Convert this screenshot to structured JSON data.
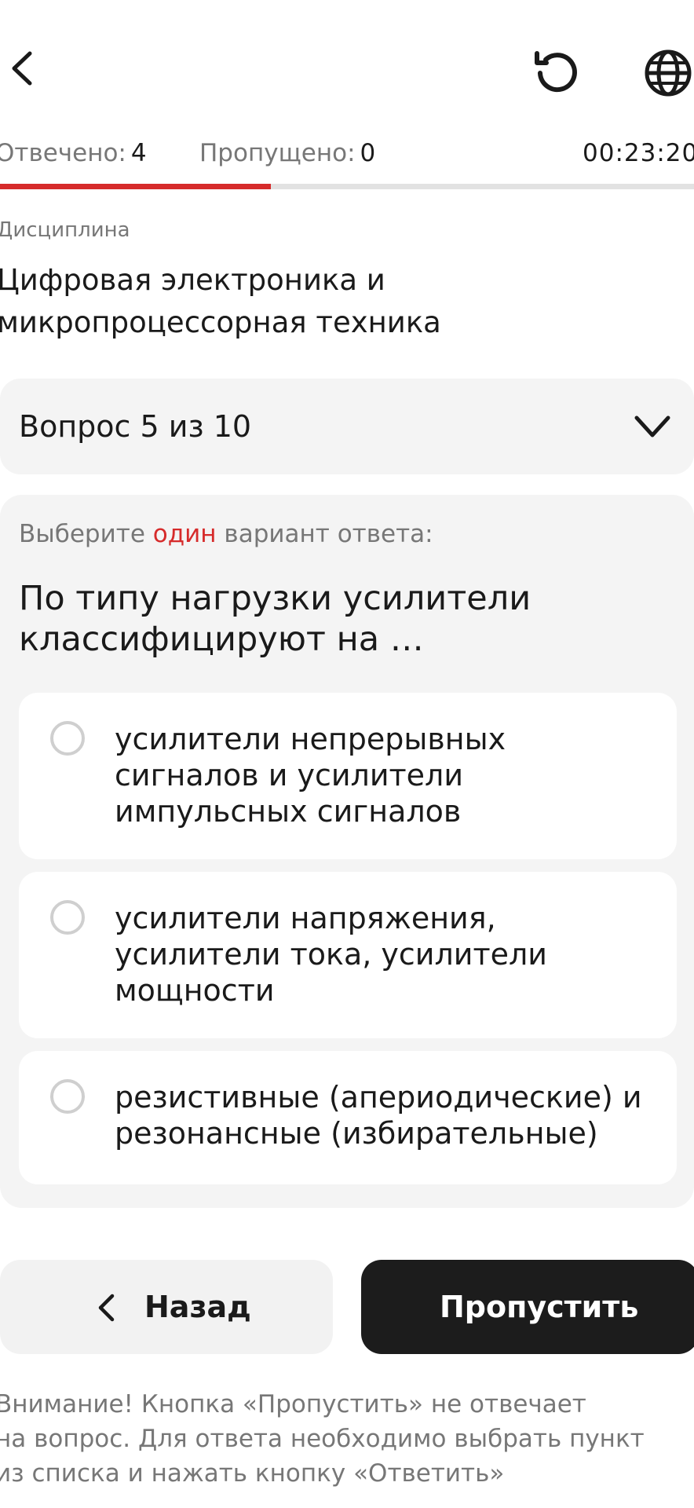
{
  "header": {
    "back_icon": "chevron-left-icon",
    "reload_icon": "reload-icon",
    "language_icon": "globe-icon"
  },
  "stats": {
    "answered_label": "Отвечено:",
    "answered_value": "4",
    "skipped_label": "Пропущено:",
    "skipped_value": "0",
    "timer": "00:23:20"
  },
  "progress": {
    "answered": 4,
    "total": 10,
    "fraction": 0.39,
    "color": "#d62b2b"
  },
  "discipline": {
    "label": "Дисциплина",
    "name": "Цифровая электроника и микропроцессорная техника"
  },
  "question_selector": {
    "label": "Вопрос 5 из 10"
  },
  "question": {
    "instruction_before": "Выберите ",
    "instruction_accent": "один",
    "instruction_after": " вариант ответа:",
    "text": "По типу нагрузки усилители классифицируют на …",
    "options": [
      {
        "text": "усилители непрерывных сигналов и усилители импульсных сигналов"
      },
      {
        "text": "усилители напряжения, усилители тока, усилители мощности"
      },
      {
        "text": "резистивные (апериодические) и резонансные (избирательные)"
      }
    ]
  },
  "buttons": {
    "back_label": "Назад",
    "skip_label": "Пропустить"
  },
  "notice": {
    "line1": "Внимание! Кнопка «Пропустить» не отвечает",
    "line2": "на вопрос. Для ответа необходимо выбрать пункт",
    "line3": "из списка и нажать кнопку «Ответить»"
  },
  "colors": {
    "accent": "#d62b2b",
    "primary_button": "#1c1c1c",
    "card_background": "#f4f4f4"
  }
}
